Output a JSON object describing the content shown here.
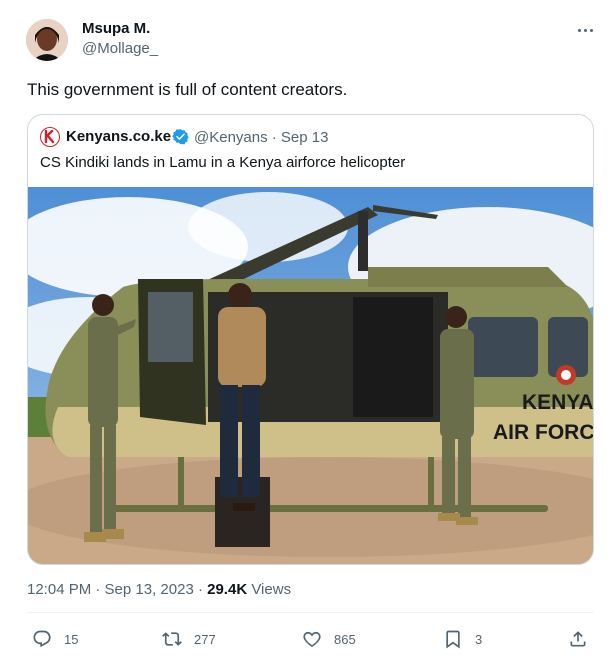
{
  "author": {
    "name": "Msupa M.",
    "handle": "@Mollage_"
  },
  "tweet": {
    "text": "This government is full of content creators."
  },
  "quote": {
    "name": "Kenyans.co.ke",
    "handle_date": "@Kenyans · Sep 13",
    "text": "CS Kindiki lands in Lamu in a Kenya airforce helicopter",
    "image_text_line1": "KENYA",
    "image_text_line2": "AIR FORCE"
  },
  "meta": {
    "time_date": "12:04 PM · Sep 13, 2023 · ",
    "views_count": "29.4K",
    "views_label": " Views"
  },
  "actions": {
    "replies": "15",
    "retweets": "277",
    "likes": "865",
    "bookmarks": "3"
  },
  "icons": {
    "more": "more-icon",
    "reply": "reply-icon",
    "retweet": "retweet-icon",
    "like": "heart-icon",
    "bookmark": "bookmark-icon",
    "share": "share-icon",
    "verified": "verified-badge-icon"
  },
  "colors": {
    "text": "#0f1419",
    "secondary": "#536471",
    "border": "#cfd9de",
    "verified": "#1d9bf0",
    "kenyans_red": "#d0202a"
  }
}
